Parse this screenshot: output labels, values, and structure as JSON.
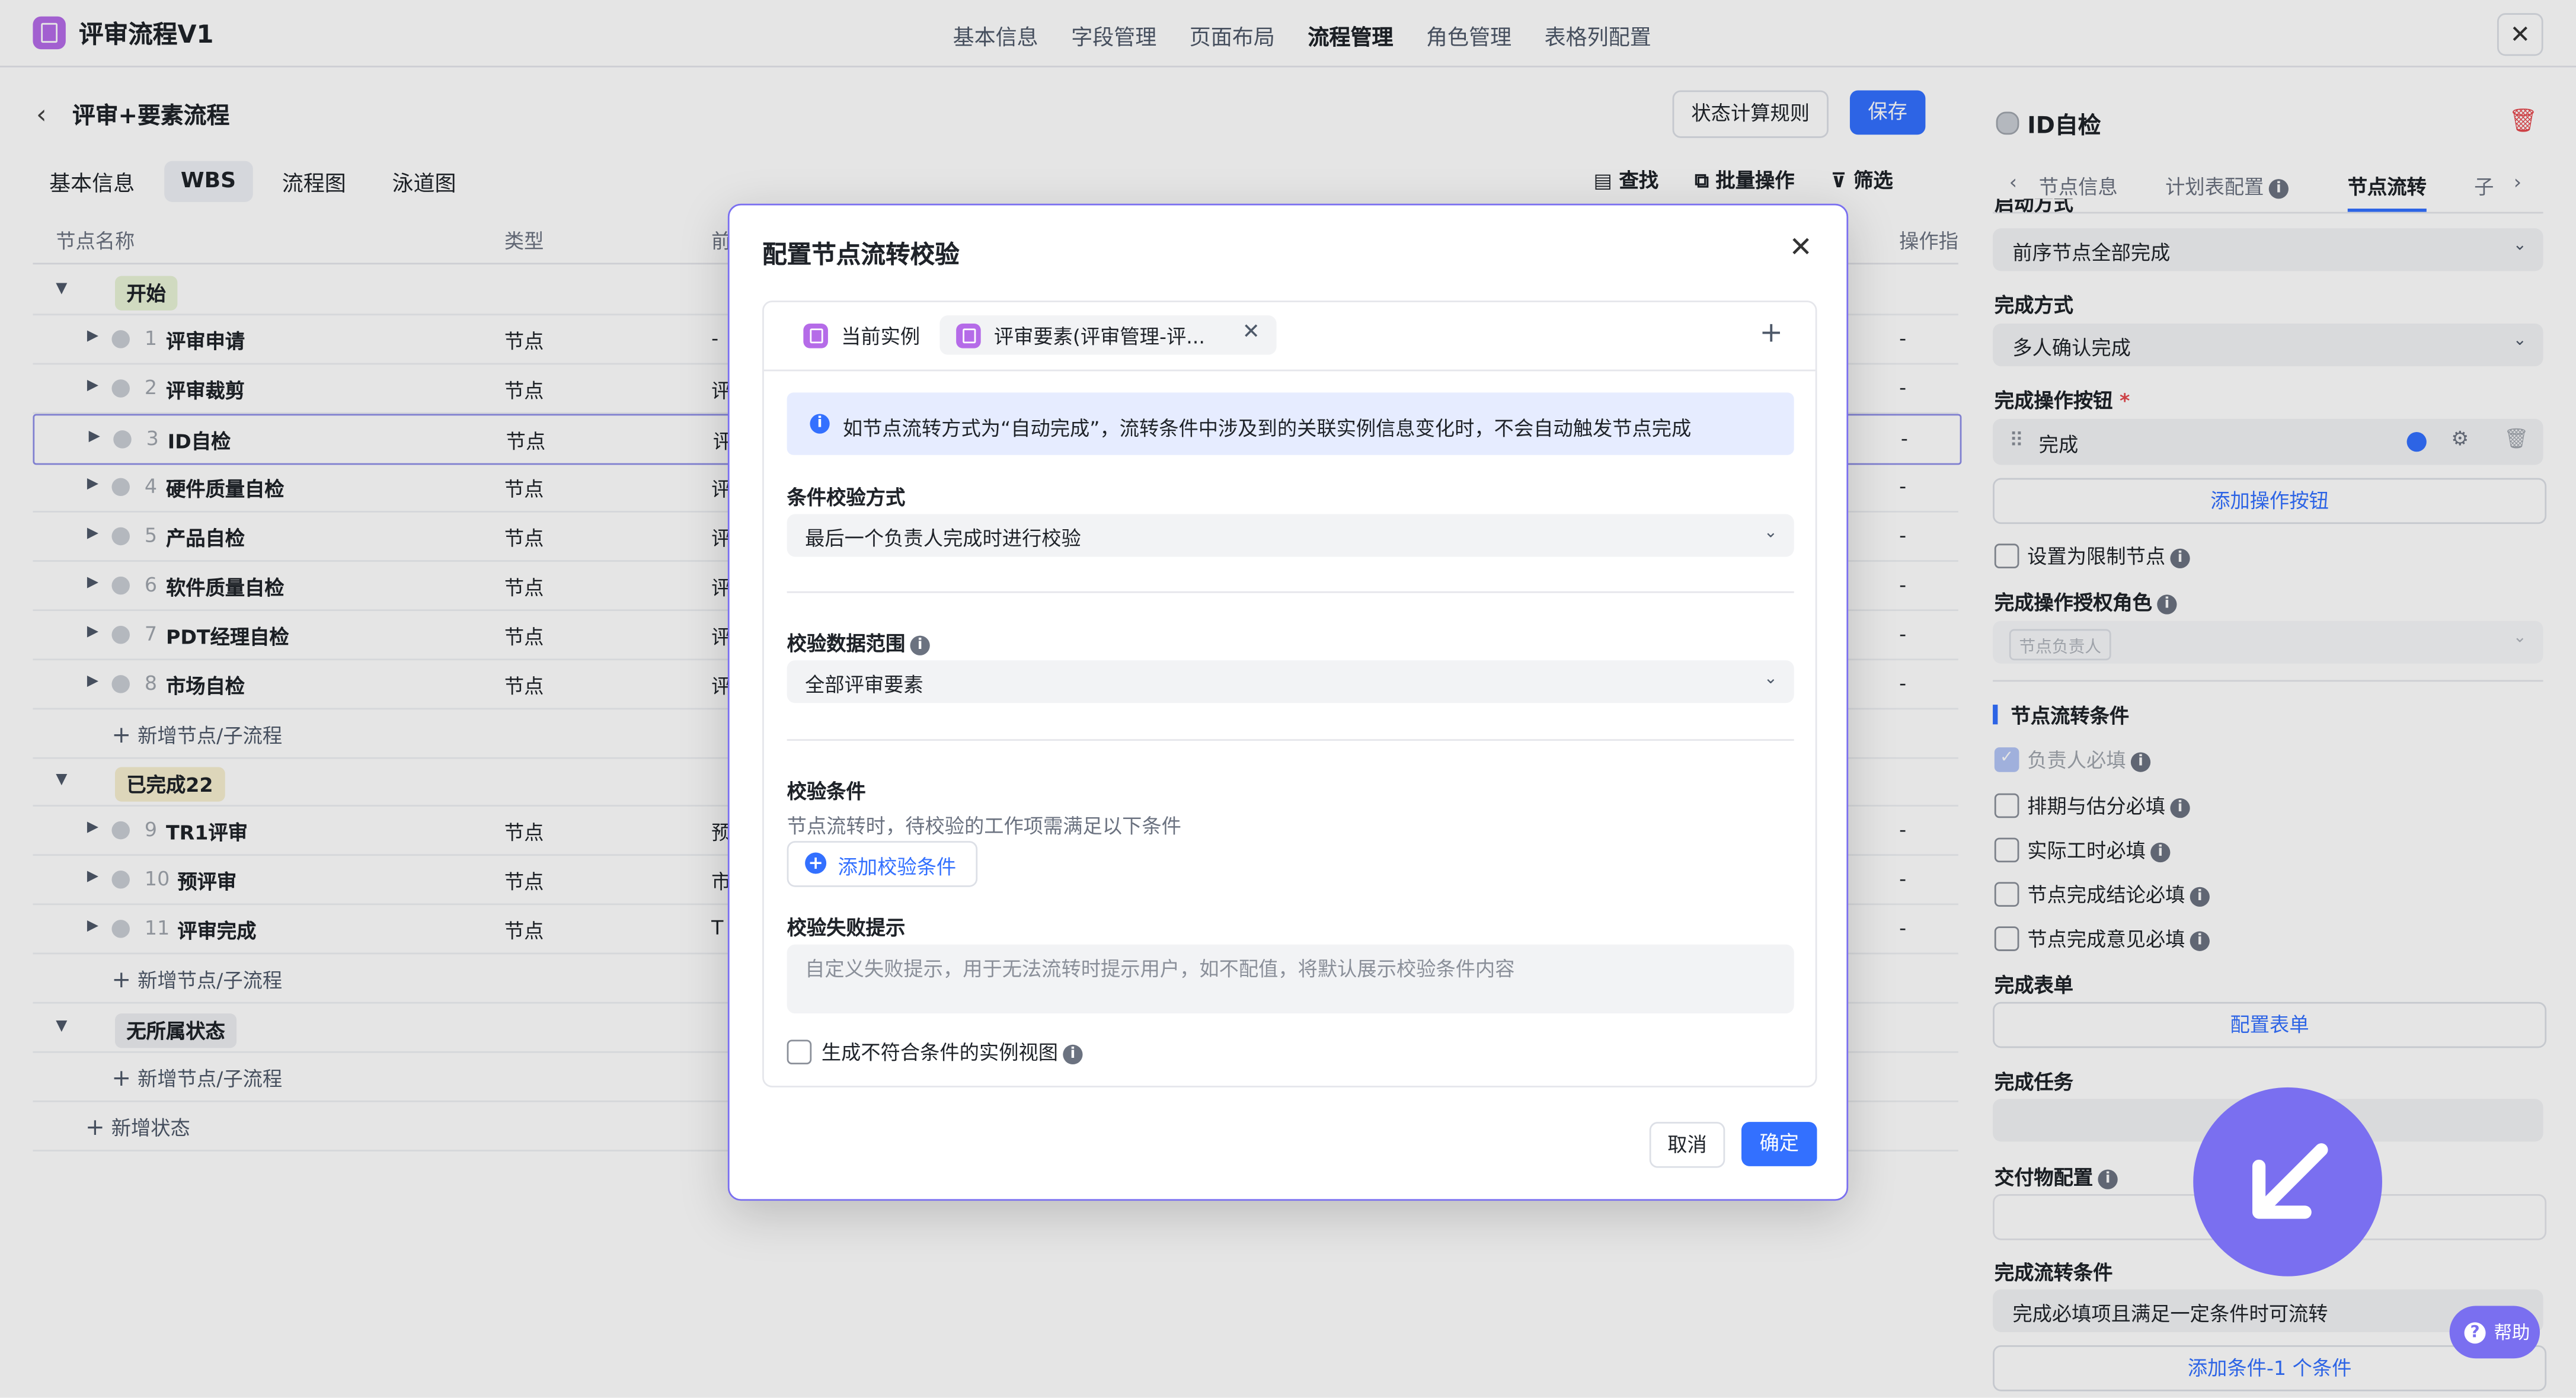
{
  "app": {
    "title": "评审流程V1",
    "close": "✕"
  },
  "top_tabs": [
    "基本信息",
    "字段管理",
    "页面布局",
    "流程管理",
    "角色管理",
    "表格列配置"
  ],
  "top_active": "流程管理",
  "page": {
    "title": "评审+要素流程",
    "state_rule_btn": "状态计算规则",
    "save_btn": "保存",
    "subtabs": [
      "基本信息",
      "WBS",
      "流程图",
      "泳道图"
    ],
    "subtab_active": "WBS",
    "tools": {
      "find": "查找",
      "batch": "批量操作",
      "filter": "筛选"
    }
  },
  "table": {
    "headers": {
      "name": "节点名称",
      "type": "类型",
      "pre": "前",
      "op": "操作指"
    },
    "groups": [
      {
        "label": "开始",
        "color": "#e8f3d6"
      },
      {
        "label": "已完成22",
        "color": "#f6efd0"
      },
      {
        "label": "无所属状态",
        "color": "#eceef1"
      }
    ],
    "rows": [
      {
        "num": "1",
        "name": "评审申请",
        "type": "节点",
        "pre": "-",
        "op": "-"
      },
      {
        "num": "2",
        "name": "评审裁剪",
        "type": "节点",
        "pre": "评",
        "op": "-"
      },
      {
        "num": "3",
        "name": "ID自检",
        "type": "节点",
        "pre": "评",
        "op": "-"
      },
      {
        "num": "4",
        "name": "硬件质量自检",
        "type": "节点",
        "pre": "评",
        "op": "-"
      },
      {
        "num": "5",
        "name": "产品自检",
        "type": "节点",
        "pre": "评",
        "op": "-"
      },
      {
        "num": "6",
        "name": "软件质量自检",
        "type": "节点",
        "pre": "评",
        "op": "-"
      },
      {
        "num": "7",
        "name": "PDT经理自检",
        "type": "节点",
        "pre": "评",
        "op": "-"
      },
      {
        "num": "8",
        "name": "市场自检",
        "type": "节点",
        "pre": "评",
        "op": "-"
      },
      {
        "num": "9",
        "name": "TR1评审",
        "type": "节点",
        "pre": "预",
        "op": "-"
      },
      {
        "num": "10",
        "name": "预评审",
        "type": "节点",
        "pre": "市",
        "op": "-"
      },
      {
        "num": "11",
        "name": "评审完成",
        "type": "节点",
        "pre": "T",
        "op": "-"
      }
    ],
    "add_node": "新增节点/子流程",
    "add_state": "新增状态"
  },
  "right_panel": {
    "node_name": "ID自检",
    "tabs": [
      "节点信息",
      "计划表配置",
      "节点流转",
      "子"
    ],
    "tab_active": "节点流转",
    "cut_label": "启动方式",
    "start_value": "前序节点全部完成",
    "finish_mode_label": "完成方式",
    "finish_mode_value": "多人确认完成",
    "finish_btn_label": "完成操作按钮",
    "required_mark": "*",
    "finish_btn_item": "完成",
    "add_op_btn": "添加操作按钮",
    "restrict_node": "设置为限制节点",
    "auth_role_label": "完成操作授权角色",
    "auth_role_placeholder": "节点负责人",
    "flow_cond_title": "节点流转条件",
    "conds": [
      "负责人必填",
      "排期与估分必填",
      "实际工时必填",
      "节点完成结论必填",
      "节点完成意见必填"
    ],
    "form_label": "完成表单",
    "form_link": "配置表单",
    "task_label": "完成任务",
    "deliver_label": "交付物配置",
    "flow_label": "完成流转条件",
    "flow_value": "完成必填项且满足一定条件时可流转",
    "add_cond_link": "添加条件-1 个条件",
    "help": "帮助"
  },
  "modal": {
    "title": "配置节点流转校验",
    "tab_current": "当前实例",
    "tab_element": "评审要素(评审管理-评...",
    "banner": "如节点流转方式为“自动完成”，流转条件中涉及到的关联实例信息变化时，不会自动触发节点完成",
    "check_mode_label": "条件校验方式",
    "check_mode_value": "最后一个负责人完成时进行校验",
    "scope_label": "校验数据范围",
    "scope_value": "全部评审要素",
    "cond_label": "校验条件",
    "cond_desc": "节点流转时，待校验的工作项需满足以下条件",
    "add_cond": "添加校验条件",
    "fail_label": "校验失败提示",
    "fail_placeholder": "自定义失败提示，用于无法流转时提示用户，如不配值，将默认展示校验条件内容",
    "gen_view": "生成不符合条件的实例视图",
    "cancel": "取消",
    "ok": "确定"
  },
  "colors": {
    "accent": "#3370ff",
    "brand": "#b56be8",
    "overlay_circle": "#7a6ff0"
  }
}
